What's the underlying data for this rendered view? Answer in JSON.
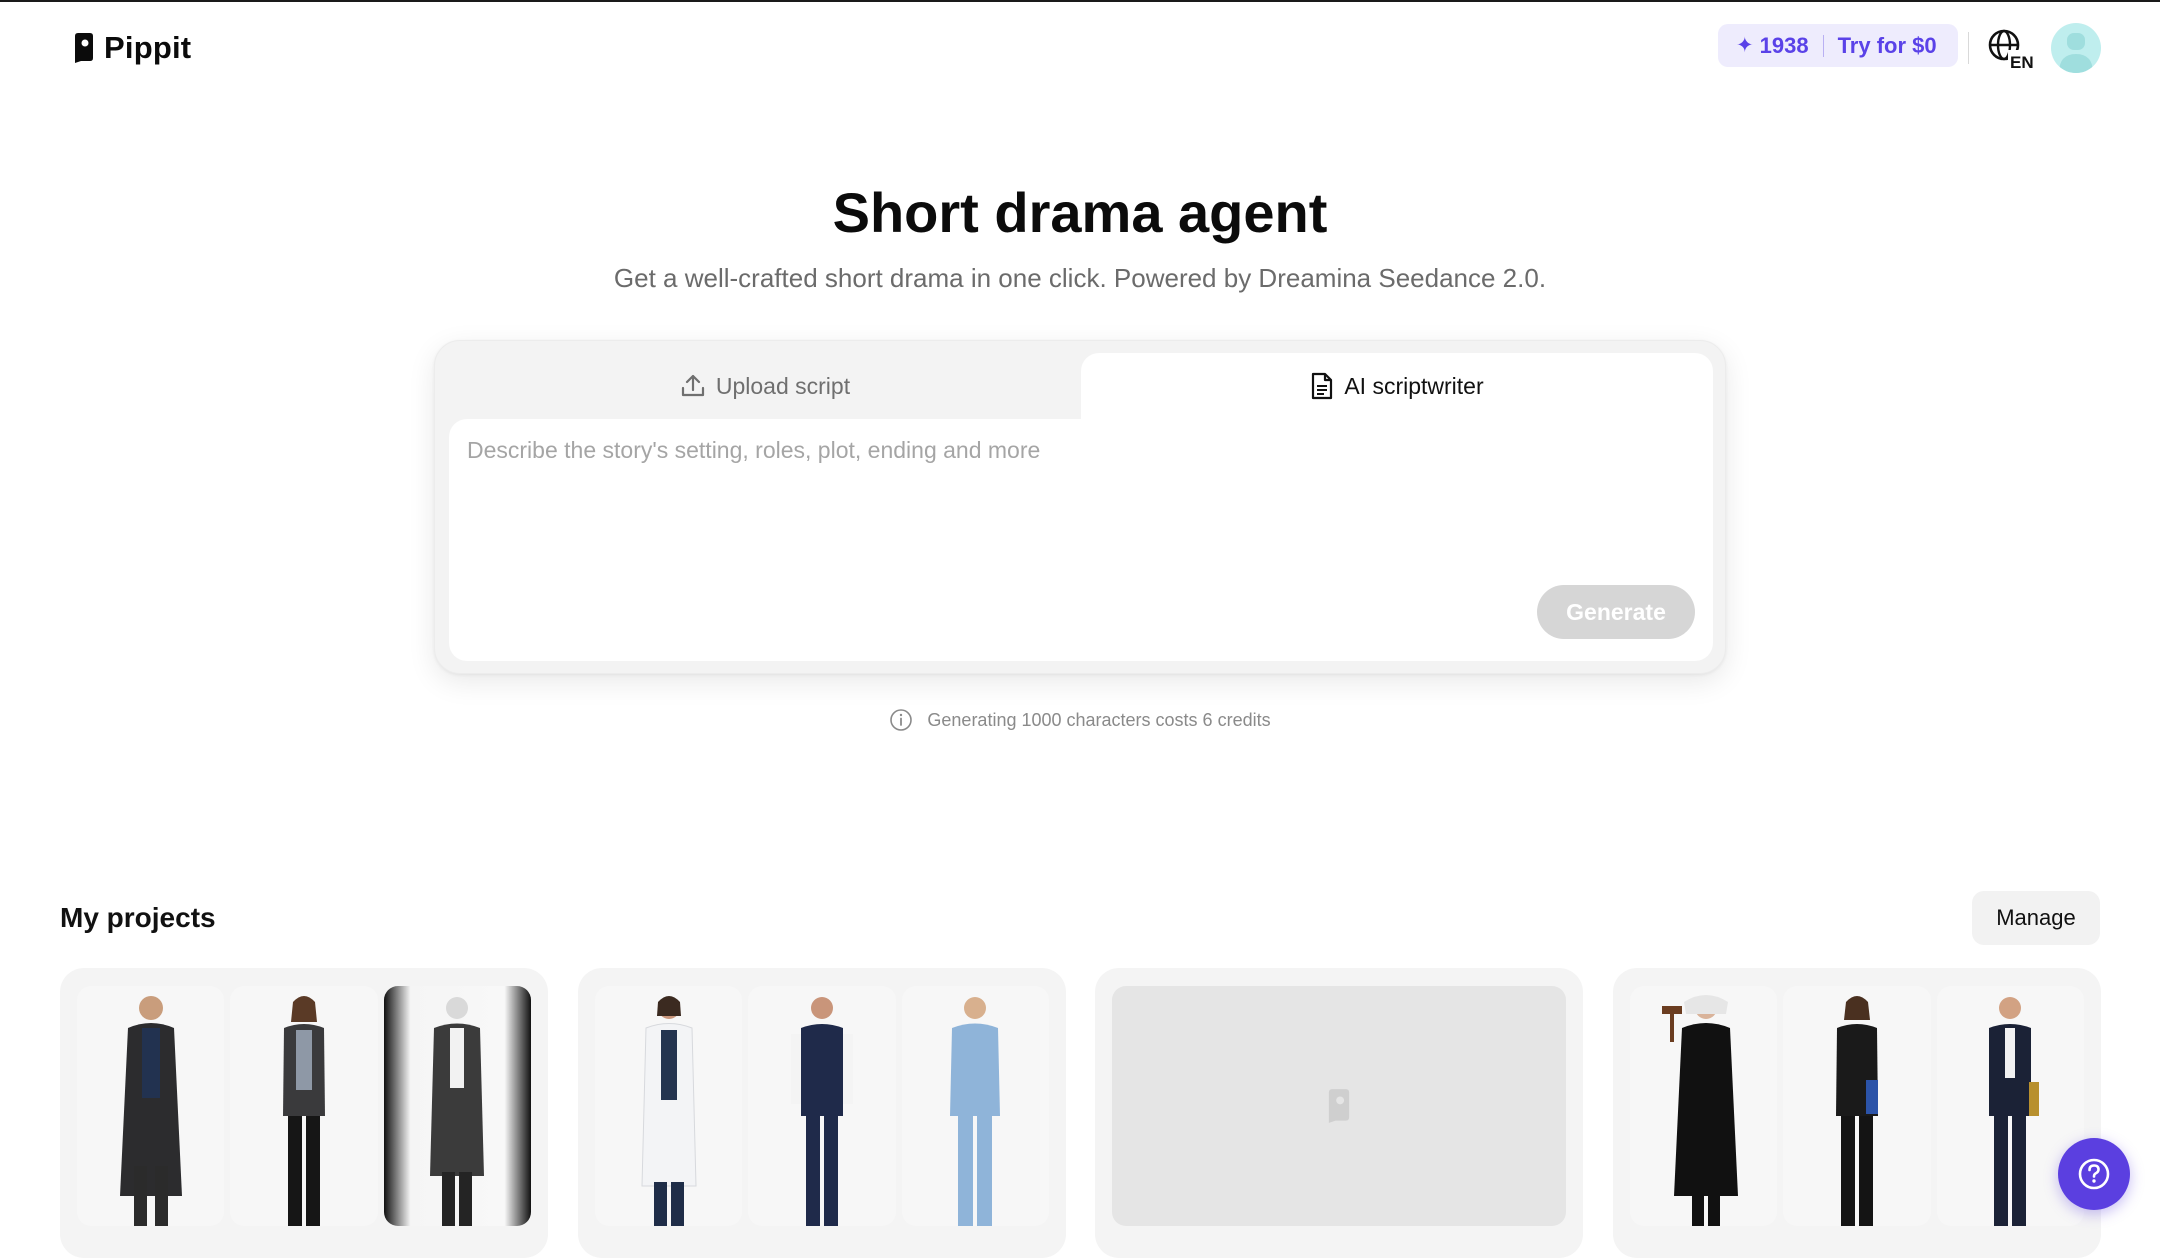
{
  "brand": {
    "name": "Pippit"
  },
  "header": {
    "credits": "1938",
    "trial_label": "Try for $0",
    "language": "EN"
  },
  "hero": {
    "title": "Short drama agent",
    "subtitle": "Get a well-crafted short drama in one click. Powered by Dreamina Seedance 2.0."
  },
  "composer": {
    "tabs": [
      {
        "label": "Upload script",
        "icon": "upload-icon",
        "active": false
      },
      {
        "label": "AI scriptwriter",
        "icon": "document-icon",
        "active": true
      }
    ],
    "placeholder": "Describe the story's setting, roles, plot, ending and more",
    "value": "",
    "generate_label": "Generate"
  },
  "credit_note": "Generating 1000 characters costs 6 credits",
  "projects": {
    "title": "My projects",
    "manage_label": "Manage",
    "cards": [
      {
        "thumbs": [
          "detective-coat",
          "detective-woman",
          "man-grey-coat"
        ]
      },
      {
        "thumbs": [
          "doctor-white-coat",
          "doctor-navy-scrubs",
          "patient-blue-scrubs"
        ]
      },
      {
        "thumbs": []
      },
      {
        "thumbs": [
          "judge-robe",
          "lawyer-woman",
          "lawyer-man"
        ]
      }
    ]
  },
  "colors": {
    "accent": "#5b3fe0",
    "credits_bg": "#eeecfd",
    "credits_text": "#5a42e8",
    "card_bg": "#f3f3f3"
  }
}
